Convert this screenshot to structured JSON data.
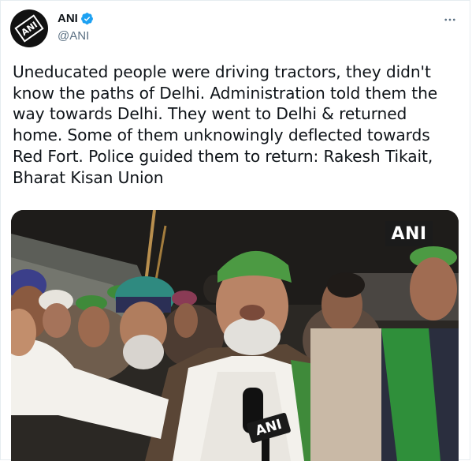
{
  "author": {
    "display_name": "ANI",
    "handle": "@ANI",
    "avatar_text": "ANI",
    "verified": true
  },
  "tweet": {
    "text_lines": [
      "Uneducated people were driving tractors, they didn't",
      "know the paths of Delhi. Administration told them the",
      "way towards Delhi. They went to Delhi & returned",
      "home. Some of them unknowingly deflected towards",
      "Red Fort. Police guided them to return: Rakesh Tikait,",
      "Bharat Kisan Union"
    ]
  },
  "media": {
    "watermark": "ANI",
    "mic_label": "ANI"
  },
  "icons": {
    "verified": "verified-badge-icon",
    "more": "more-options-icon"
  },
  "colors": {
    "verified_blue": "#1da1f2",
    "secondary_text": "#5b7083",
    "turban_green": "#3f8a3a"
  }
}
